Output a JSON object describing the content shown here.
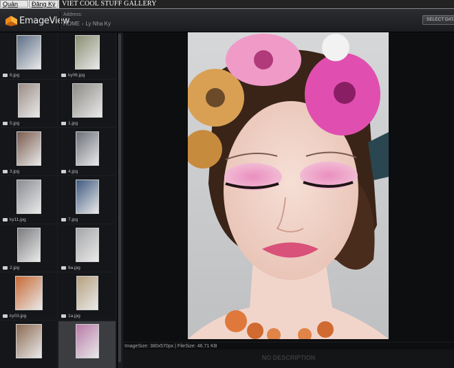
{
  "site": {
    "tabs": [
      "Quản Lý",
      "Đăng Ký"
    ],
    "title": "VIET COOL STUFF GALLERY"
  },
  "app": {
    "logo_text": "EmageView",
    "address_label": "Address:",
    "breadcrumb": [
      "HOME",
      "Ly Nha Ky"
    ],
    "select_button": "SELECT DATABASE"
  },
  "thumbnails": [
    {
      "file": "6.jpg",
      "selected": false
    },
    {
      "file": "ky06.jpg",
      "selected": false
    },
    {
      "file": "5.jpg",
      "selected": false
    },
    {
      "file": "1.jpg",
      "selected": false
    },
    {
      "file": "3.jpg",
      "selected": false
    },
    {
      "file": "4.jpg",
      "selected": false
    },
    {
      "file": "ky11.jpg",
      "selected": false
    },
    {
      "file": "7.jpg",
      "selected": false
    },
    {
      "file": "2.jpg",
      "selected": false
    },
    {
      "file": "6a.jpg",
      "selected": false
    },
    {
      "file": "ky03.jpg",
      "selected": false
    },
    {
      "file": "1a.jpg",
      "selected": false
    },
    {
      "file": "",
      "selected": false
    },
    {
      "file": "",
      "selected": true
    }
  ],
  "viewer": {
    "info": "ImageSize: 380x570px | FileSize: 46.71 KB",
    "description": "NO DESCRIPTION"
  },
  "colors": {
    "background": "#111215",
    "selected_cell": "#3c3d41",
    "accent_pink": "#e04fb0"
  }
}
